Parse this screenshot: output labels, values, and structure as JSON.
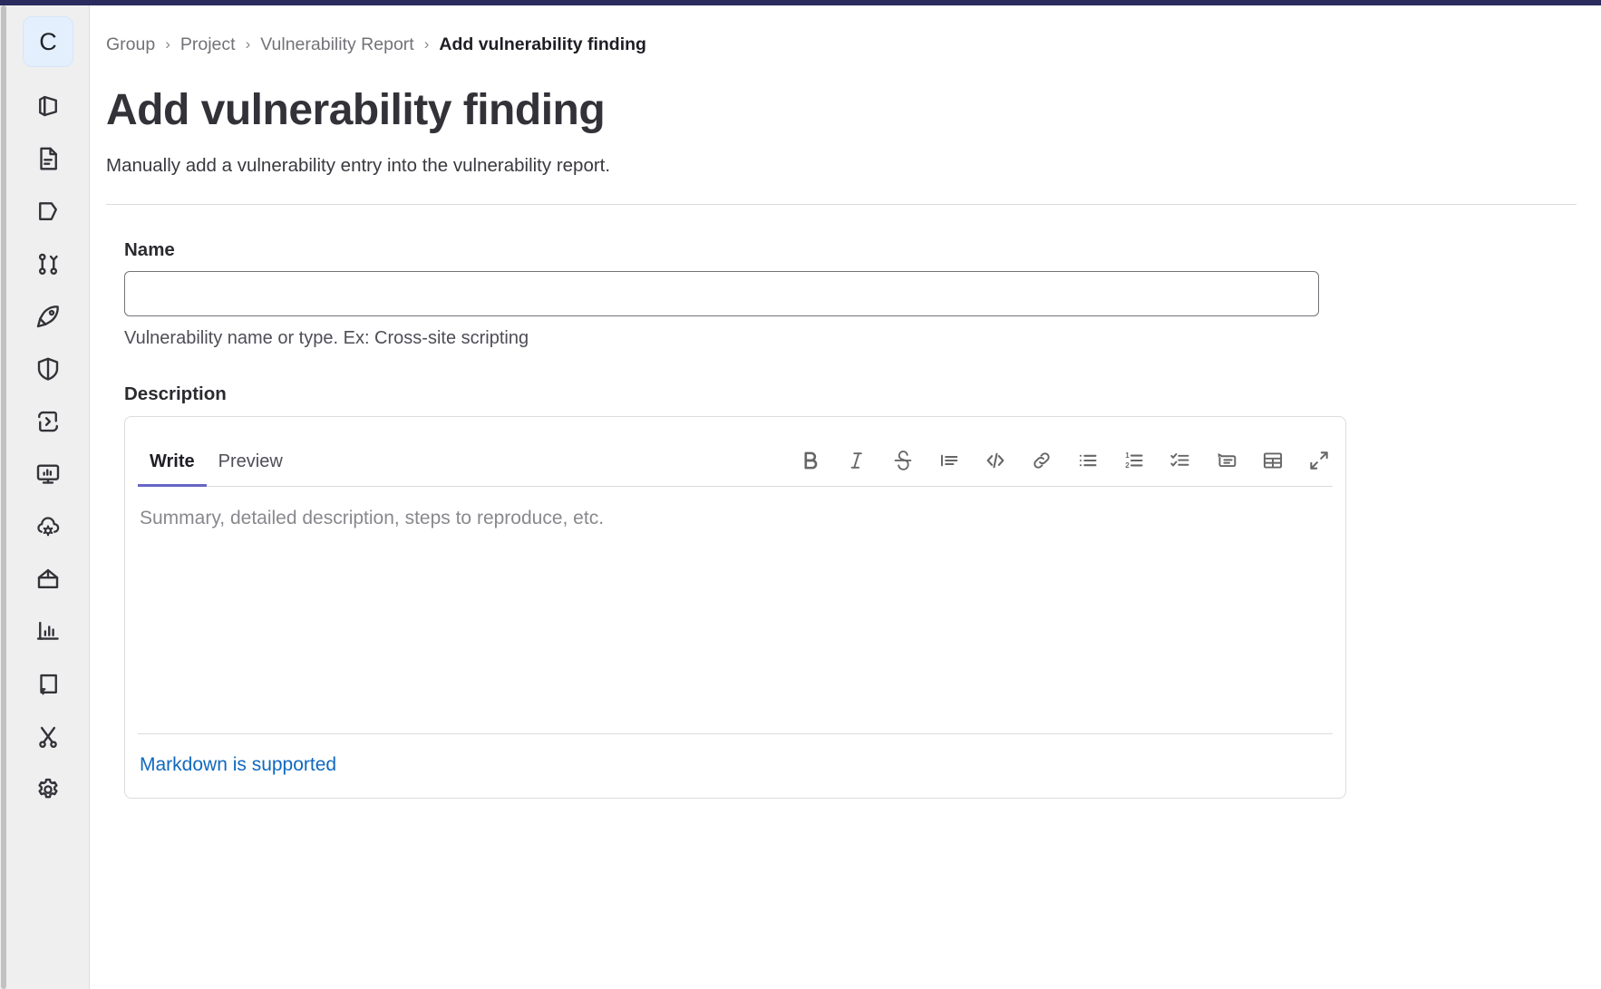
{
  "theme": {
    "topbar_color": "#2b2b5e",
    "accent_color": "#6666c4",
    "link_color": "#1068bf",
    "sidebar_bg": "#efefef",
    "avatar_bg": "#e3effc"
  },
  "sidebar": {
    "avatar_initial": "C",
    "items": [
      {
        "icon": "project-overview-icon",
        "name": "sidebar-item-project-overview"
      },
      {
        "icon": "file-document-icon",
        "name": "sidebar-item-repository"
      },
      {
        "icon": "issues-icon",
        "name": "sidebar-item-issues"
      },
      {
        "icon": "merge-request-icon",
        "name": "sidebar-item-merge-requests"
      },
      {
        "icon": "rocket-icon",
        "name": "sidebar-item-build"
      },
      {
        "icon": "shield-icon",
        "name": "sidebar-item-secure"
      },
      {
        "icon": "deployments-icon",
        "name": "sidebar-item-deploy"
      },
      {
        "icon": "monitor-icon",
        "name": "sidebar-item-monitor"
      },
      {
        "icon": "cloud-gear-icon",
        "name": "sidebar-item-operate"
      },
      {
        "icon": "package-icon",
        "name": "sidebar-item-packages"
      },
      {
        "icon": "chart-icon",
        "name": "sidebar-item-analyze"
      },
      {
        "icon": "book-icon",
        "name": "sidebar-item-wiki"
      },
      {
        "icon": "scissors-icon",
        "name": "sidebar-item-snippets"
      },
      {
        "icon": "gear-icon",
        "name": "sidebar-item-settings"
      }
    ]
  },
  "breadcrumb": {
    "separator": "›",
    "items": [
      {
        "label": "Group",
        "current": false
      },
      {
        "label": "Project",
        "current": false
      },
      {
        "label": "Vulnerability Report",
        "current": false
      },
      {
        "label": "Add vulnerability finding",
        "current": true
      }
    ]
  },
  "header": {
    "title": "Add vulnerability finding",
    "subtitle": "Manually add a vulnerability entry into the vulnerability report."
  },
  "form": {
    "name": {
      "label": "Name",
      "value": "",
      "placeholder": "",
      "help": "Vulnerability name or type. Ex: Cross-site scripting"
    },
    "description": {
      "label": "Description",
      "value": "",
      "placeholder": "Summary, detailed description, steps to reproduce, etc.",
      "footer_link": "Markdown is supported",
      "tabs": [
        {
          "label": "Write",
          "active": true
        },
        {
          "label": "Preview",
          "active": false
        }
      ],
      "toolbar": [
        {
          "icon": "bold-icon",
          "name": "toolbar-bold-button",
          "title": "Bold"
        },
        {
          "icon": "italic-icon",
          "name": "toolbar-italic-button",
          "title": "Italic"
        },
        {
          "icon": "strikethrough-icon",
          "name": "toolbar-strikethrough-button",
          "title": "Strikethrough"
        },
        {
          "icon": "quote-icon",
          "name": "toolbar-quote-button",
          "title": "Insert a quote"
        },
        {
          "icon": "code-icon",
          "name": "toolbar-code-button",
          "title": "Insert code"
        },
        {
          "icon": "link-icon",
          "name": "toolbar-link-button",
          "title": "Insert a link"
        },
        {
          "icon": "bullet-list-icon",
          "name": "toolbar-bullet-list-button",
          "title": "Add a bullet list"
        },
        {
          "icon": "numbered-list-icon",
          "name": "toolbar-numbered-list-button",
          "title": "Add a numbered list"
        },
        {
          "icon": "task-list-icon",
          "name": "toolbar-task-list-button",
          "title": "Add a checklist"
        },
        {
          "icon": "collapsible-section-icon",
          "name": "toolbar-collapsible-section-button",
          "title": "Add a collapsible section"
        },
        {
          "icon": "table-icon",
          "name": "toolbar-table-button",
          "title": "Add a table"
        },
        {
          "icon": "fullscreen-icon",
          "name": "toolbar-fullscreen-button",
          "title": "Go full screen"
        }
      ]
    }
  }
}
